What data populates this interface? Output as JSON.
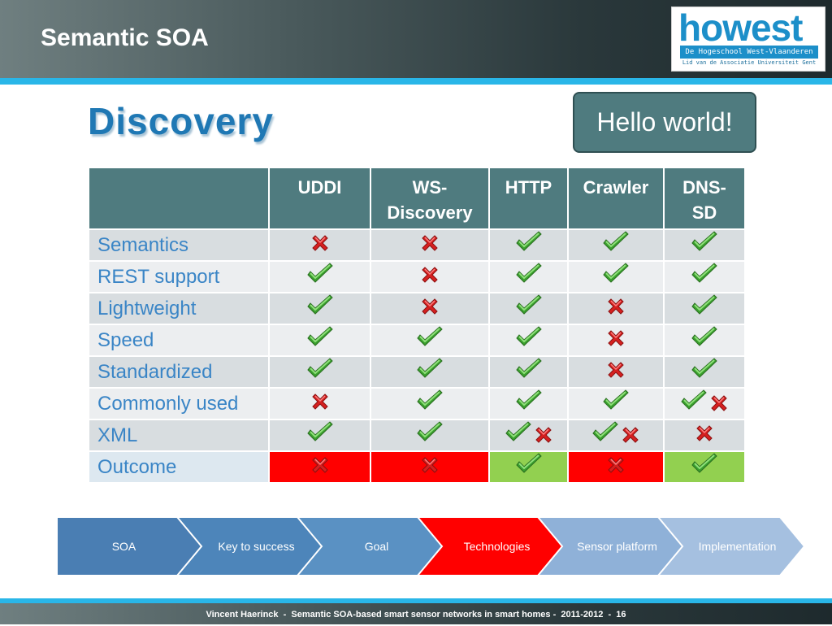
{
  "slide": {
    "title": "Semantic SOA",
    "heading": "Discovery",
    "callout": "Hello world!"
  },
  "logo": {
    "word": "howest",
    "band": "De Hogeschool West-Vlaanderen",
    "sub": "Lid van de Associatie Universiteit Gent"
  },
  "table": {
    "columns": [
      "UDDI",
      "WS-\nDiscovery",
      "HTTP",
      "Crawler",
      "DNS-\nSD"
    ],
    "rows": [
      {
        "label": "Semantics",
        "cells": [
          "x",
          "x",
          "check",
          "check",
          "check"
        ]
      },
      {
        "label": "REST support",
        "cells": [
          "check",
          "x",
          "check",
          "check",
          "check"
        ]
      },
      {
        "label": "Lightweight",
        "cells": [
          "check",
          "x",
          "check",
          "x",
          "check"
        ]
      },
      {
        "label": "Speed",
        "cells": [
          "check",
          "check",
          "check",
          "x",
          "check"
        ]
      },
      {
        "label": "Standardized",
        "cells": [
          "check",
          "check",
          "check",
          "x",
          "check"
        ]
      },
      {
        "label": "Commonly used",
        "cells": [
          "x",
          "check",
          "check",
          "check",
          "check+x"
        ]
      },
      {
        "label": "XML",
        "cells": [
          "check",
          "check",
          "check+x",
          "check+x",
          "x"
        ]
      },
      {
        "label": "Outcome",
        "cells": [
          "x",
          "x",
          "check",
          "x",
          "check"
        ],
        "backgrounds": [
          "red",
          "red",
          "green",
          "red",
          "green"
        ]
      }
    ]
  },
  "nav": {
    "items": [
      {
        "label": "SOA",
        "color": "#4a7eb3"
      },
      {
        "label": "Key to success",
        "color": "#4d85ba"
      },
      {
        "label": "Goal",
        "color": "#5a91c3"
      },
      {
        "label": "Technologies",
        "color": "#ff0000"
      },
      {
        "label": "Sensor platform",
        "color": "#8fb1d8"
      },
      {
        "label": "Implementation",
        "color": "#a5c0e0"
      }
    ]
  },
  "footer": {
    "text": "Vincent Haerinck  -  Semantic SOA-based smart sensor networks in smart homes -  2011-2012  -  16"
  },
  "icons": {
    "check": "check-icon",
    "x": "x-icon"
  },
  "colors": {
    "header_band": "#29b6e8",
    "table_header": "#4f7b7f",
    "row_label": "#3a85c6",
    "outcome_red": "#ff0000",
    "outcome_green": "#92d050"
  }
}
